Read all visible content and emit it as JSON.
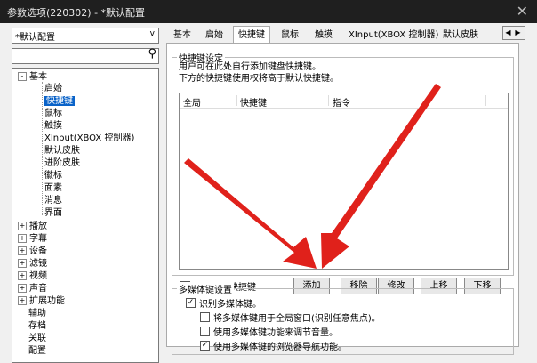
{
  "window": {
    "title": "参数选项(220302) - *默认配置",
    "close_glyph": "✕"
  },
  "preset": {
    "value": "*默认配置",
    "dropdown_glyph": "v"
  },
  "search": {
    "glyph": "⚲"
  },
  "tree": {
    "items": [
      {
        "label": "基本",
        "expander": "-"
      },
      {
        "label": "启始"
      },
      {
        "label": "快捷键",
        "selected": true
      },
      {
        "label": "鼠标"
      },
      {
        "label": "触摸"
      },
      {
        "label": "XInput(XBOX 控制器)"
      },
      {
        "label": "默认皮肤"
      },
      {
        "label": "进阶皮肤"
      },
      {
        "label": "徽标"
      },
      {
        "label": "面素"
      },
      {
        "label": "消息"
      },
      {
        "label": "界面"
      },
      {
        "label": "播放",
        "expander": "+"
      },
      {
        "label": "字幕",
        "expander": "+"
      },
      {
        "label": "设备",
        "expander": "+"
      },
      {
        "label": "滤镜",
        "expander": "+"
      },
      {
        "label": "视频",
        "expander": "+"
      },
      {
        "label": "声音",
        "expander": "+"
      },
      {
        "label": "扩展功能",
        "expander": "+"
      },
      {
        "label": "辅助"
      },
      {
        "label": "存档"
      },
      {
        "label": "关联"
      },
      {
        "label": "配置"
      }
    ]
  },
  "tabs": {
    "items": [
      "基本",
      "启始",
      "快捷键",
      "鼠标",
      "触摸",
      "XInput(XBOX 控制器)",
      "默认皮肤"
    ],
    "active_index": 2,
    "scroll_left": "◀",
    "scroll_right": "▶"
  },
  "shortcut_group": {
    "legend": "快捷键设定",
    "desc_line1": "用户可在此处自行添加键盘快捷键。",
    "desc_line2": "下方的快捷键使用权将高于默认快捷键。",
    "columns": [
      "全局",
      "快捷键",
      "指令"
    ],
    "ignore_default_label": "忽略默认快捷键",
    "ignore_default_checked": false,
    "buttons": {
      "add": "添加",
      "remove": "移除",
      "edit": "修改",
      "up": "上移",
      "down": "下移"
    }
  },
  "media_group": {
    "legend": "多媒体键设置",
    "options": [
      {
        "label": "识别多媒体键。",
        "checked": true
      },
      {
        "label": "将多媒体键用于全局窗口(识别任意焦点)。",
        "checked": false
      },
      {
        "label": "使用多媒体键功能来调节音量。",
        "checked": false
      },
      {
        "label": "使用多媒体键的浏览器导航功能。",
        "checked": true
      }
    ]
  },
  "colors": {
    "titlebar": "#1f1f1f",
    "selection": "#0a63c9",
    "arrow": "#e0211b"
  }
}
